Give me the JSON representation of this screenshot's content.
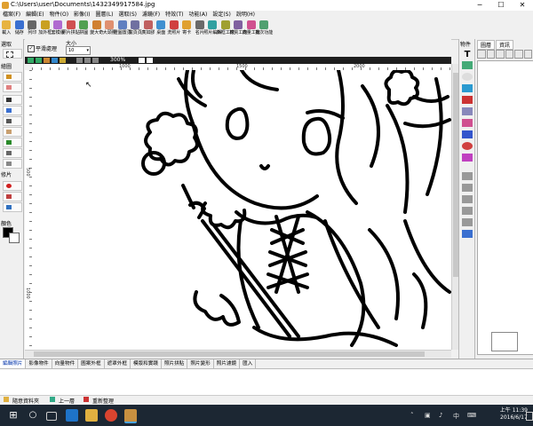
{
  "window": {
    "title": "C:\\Users\\user\\Documents\\1432349917584.jpg",
    "controls": {
      "minimize": "─",
      "maximize": "☐",
      "close": "✕"
    }
  },
  "menu": [
    "檔案(F)",
    "編輯(E)",
    "物件(O)",
    "影像(I)",
    "圖層(L)",
    "選取(S)",
    "濾鏡(F)",
    "特效(T)",
    "功能(A)",
    "設定(S)",
    "說明(H)"
  ],
  "toolbar": [
    {
      "label": "載入",
      "color": "#e7b341"
    },
    {
      "label": "儲存",
      "color": "#3a6fd0"
    },
    {
      "label": "列印",
      "color": "#666666"
    },
    {
      "label": "加外框",
      "color": "#c9a020"
    },
    {
      "label": "套模版",
      "color": "#b06ad0"
    },
    {
      "label": "照片拼貼",
      "color": "#d05050"
    },
    {
      "label": "拼圖",
      "color": "#50a050"
    },
    {
      "label": "變大奇",
      "color": "#d08030"
    },
    {
      "label": "大頭照",
      "color": "#e09070"
    },
    {
      "label": "證圖置頁",
      "color": "#6080c0"
    },
    {
      "label": "寬頁頁",
      "color": "#7070a0"
    },
    {
      "label": "廣如膠",
      "color": "#c06060"
    },
    {
      "label": "桌面",
      "color": "#4090d0"
    },
    {
      "label": "洗照片",
      "color": "#d04040"
    },
    {
      "label": "寄卡",
      "color": "#e0a030"
    },
    {
      "label": "名片",
      "color": "#6a6a6a"
    },
    {
      "label": "照片編輯",
      "color": "#30a0a0"
    },
    {
      "label": "外框工廠",
      "color": "#a0a030"
    },
    {
      "label": "材質工廠",
      "color": "#8060a0"
    },
    {
      "label": "向量工廠",
      "color": "#d05090"
    },
    {
      "label": "批次功能",
      "color": "#50a070"
    }
  ],
  "left_panel": {
    "section_select": "選取",
    "section_draw": "繪圖",
    "section_photo": "修片",
    "section_color": "顏色"
  },
  "options": {
    "smooth_label": "平滑處理",
    "smooth_checked": true,
    "size_label": "大小",
    "size_value": "10"
  },
  "nav": {
    "zoom": "300%"
  },
  "ruler": {
    "h_marks": [
      "1000",
      "1500",
      "2000"
    ],
    "v_marks": [
      "500",
      "1000",
      "1500"
    ]
  },
  "right_panel": {
    "header": "物件",
    "layer_tab": "圖層",
    "info_tab": "資訊"
  },
  "bottom_tabs": [
    "編輯照片",
    "影像物件",
    "向量物件",
    "圖案外框",
    "遮罩外框",
    "模版和實踐",
    "照片拼貼",
    "照片變形",
    "照片濾鏡",
    "匯入"
  ],
  "statusbar": {
    "help": "隨意資料夾",
    "prev": "上一層",
    "refresh": "重新整理"
  },
  "taskbar": {
    "time": "上午 11:39",
    "date": "2016/6/17",
    "lang": "中"
  }
}
